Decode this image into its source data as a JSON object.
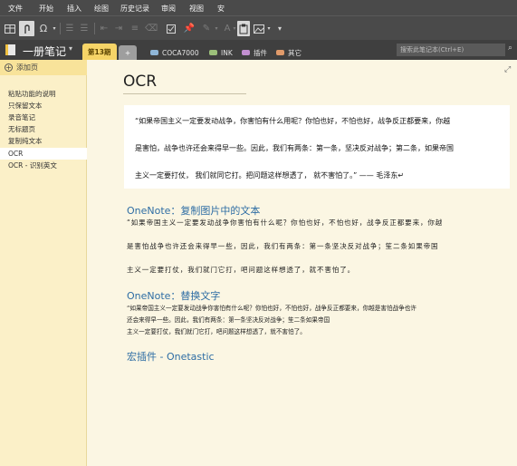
{
  "menu": [
    "文件",
    "开始",
    "插入",
    "绘图",
    "历史记录",
    "审阅",
    "视图",
    "安"
  ],
  "notebook": {
    "name": "一册笔记"
  },
  "sections": [
    {
      "label": "第13期",
      "active": true
    },
    {
      "label": "+",
      "add": true
    },
    {
      "label": "COCA7000",
      "color": "#8fb6d8"
    },
    {
      "label": "INK",
      "color": "#9cc07a"
    },
    {
      "label": "插件",
      "color": "#c28fd0"
    },
    {
      "label": "其它",
      "color": "#e09a6a"
    }
  ],
  "search": {
    "placeholder": "搜索此笔记本(Ctrl+E)"
  },
  "sidebar": {
    "add_page": "添加页",
    "pages": [
      {
        "label": "粘贴功能的说明"
      },
      {
        "label": "只保留文本"
      },
      {
        "label": "录音笔记"
      },
      {
        "label": "无标题页"
      },
      {
        "label": "复制纯文本"
      },
      {
        "label": "OCR",
        "selected": true
      },
      {
        "label": "OCR - 识别英文"
      }
    ]
  },
  "page": {
    "title": "OCR",
    "quote": [
      "“如果帝国主义一定要发动战争，你害怕有什么用呢？你怕也好，不怕也好，战争反正都要来，你越",
      "是害怕，战争也许还会来得早一些。因此，我们有两条：第一条，坚决反对战争；第二条，如果帝国",
      "主义一定要打仗，   我们就同它打。把问题这样想透了，   就不害怕了。”   —— 毛泽东↵"
    ],
    "section1": {
      "heading": "OneNote：复制图片中的文本",
      "lines": [
        "“如果帝国主义一定要发动战争你害怕有什么呢？你怕也好，不怕也好，战争反正都要来，你越",
        "是害怕战争也许还会来得早一些，因此，我们有两条：第一条坚决反对战争；笙二条如果帝国",
        "主义一定要打仗，我们就门它打，吧问题这样想透了，就不害怕了。"
      ]
    },
    "section2": {
      "heading": "OneNote：替换文字",
      "lines": [
        "“如果帝国主义一定要发动战争你害怕有什么呢？你怕也好，不怕也好，战争反正都要来，你越是害怕战争也许",
        "还会来得早一些。因此，我们有两条：第一条坚决反对战争；笙二条如果帝国",
        "主义一定要打仗，我们就门它打，吧问题这样想透了，就不害怕了。"
      ]
    },
    "section3": {
      "heading": "宏插件 - Onetastic"
    }
  }
}
